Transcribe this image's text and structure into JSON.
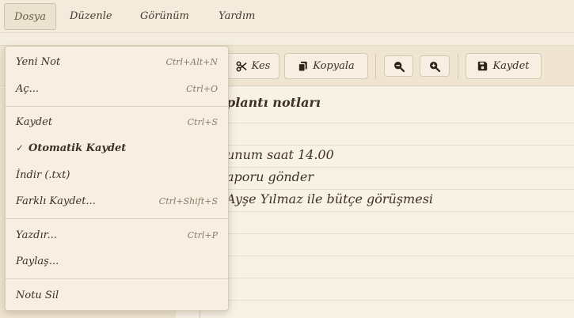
{
  "menubar": {
    "items": [
      "Dosya",
      "Düzenle",
      "Görünüm",
      "Yardım"
    ]
  },
  "toolbar": {
    "cut_label": "Kes",
    "copy_label": "Kopyala",
    "save_label": "Kaydet"
  },
  "editor": {
    "lines": [
      "plantı notları",
      "",
      "unum saat 14.00",
      "aporu gönder",
      "Ayşe Yılmaz ile bütçe görüşmesi"
    ]
  },
  "file_menu": {
    "items": [
      {
        "label": "Yeni Not",
        "shortcut": "Ctrl+Alt+N"
      },
      {
        "label": "Aç...",
        "shortcut": "Ctrl+O"
      },
      {
        "label": "Kaydet",
        "shortcut": "Ctrl+S"
      },
      {
        "label": "Otomatik Kaydet",
        "shortcut": "",
        "checked": true
      },
      {
        "label": "İndir (.txt)",
        "shortcut": ""
      },
      {
        "label": "Farklı Kaydet...",
        "shortcut": "Ctrl+Shift+S"
      },
      {
        "label": "Yazdır...",
        "shortcut": "Ctrl+P"
      },
      {
        "label": "Paylaş...",
        "shortcut": ""
      },
      {
        "label": "Notu Sil",
        "shortcut": ""
      }
    ],
    "check_glyph": "✓"
  },
  "colors": {
    "background": "#f5eee0",
    "text": "#4a3b2e",
    "border": "#d6c9b2"
  }
}
